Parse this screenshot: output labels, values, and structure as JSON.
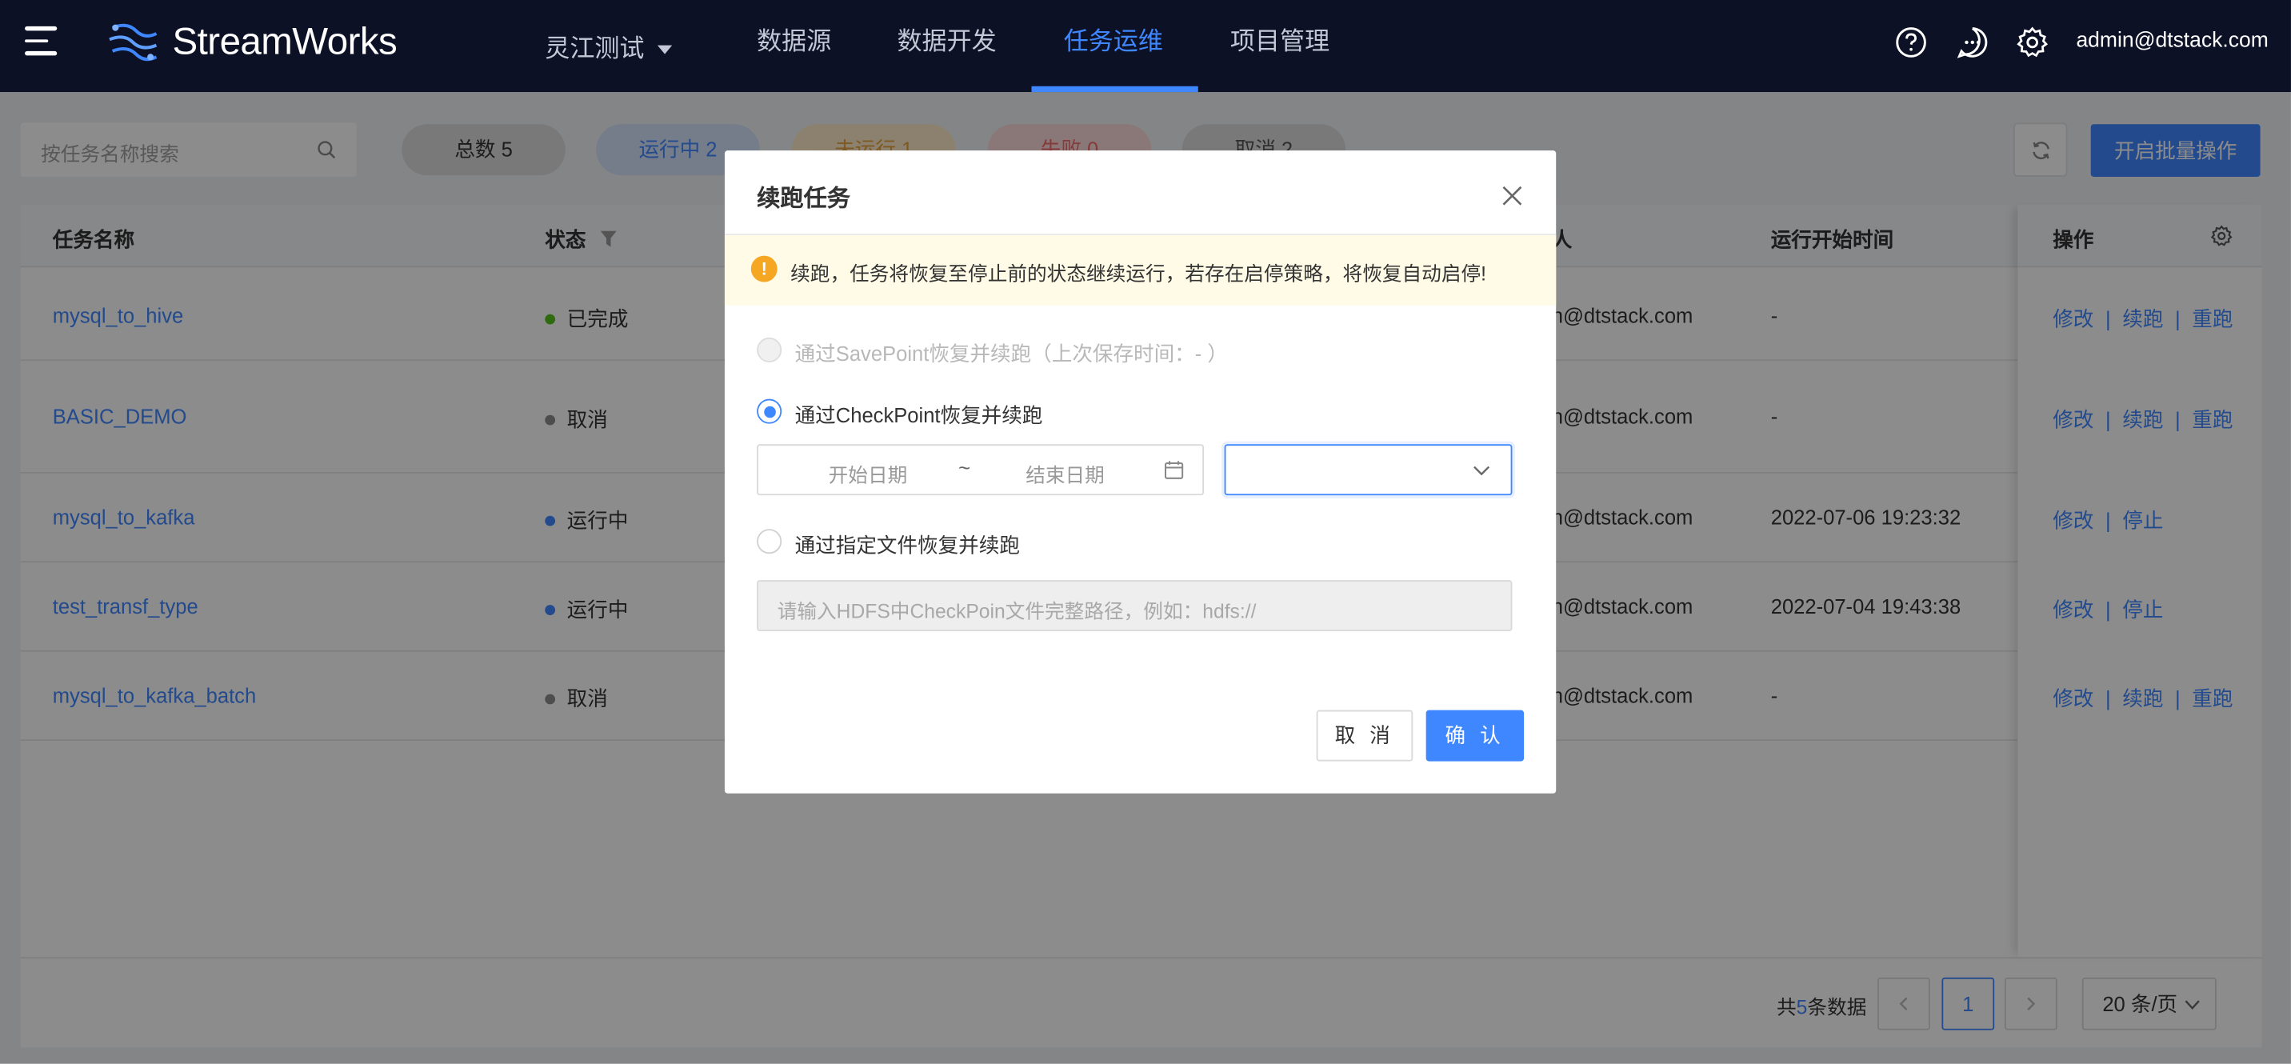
{
  "app": {
    "name": "StreamWorks",
    "user": "admin@dtstack.com"
  },
  "nav": {
    "project": "灵江测试",
    "items": [
      "数据源",
      "数据开发",
      "任务运维",
      "项目管理"
    ],
    "active_index": 2
  },
  "toolbar": {
    "search_placeholder": "按任务名称搜索",
    "filters": [
      {
        "label": "总数 5",
        "color": "#dcdcdc",
        "text_color": "#333333"
      },
      {
        "label": "运行中 2",
        "color": "#d6e4fc",
        "text_color": "#3f87ff"
      },
      {
        "label": "未运行 1",
        "color": "#fdecc8",
        "text_color": "#e6a23c"
      },
      {
        "label": "失败 0",
        "color": "#fcd9d9",
        "text_color": "#f56c6c"
      },
      {
        "label": "取消 2",
        "color": "#dcdcdc",
        "text_color": "#555555"
      }
    ],
    "batch_label": "开启批量操作"
  },
  "table": {
    "columns": {
      "name": "任务名称",
      "status": "状态",
      "owner_suffix": "人",
      "start_time": "运行开始时间",
      "ops": "操作"
    },
    "rows": [
      {
        "name": "mysql_to_hive",
        "status": "已完成",
        "status_color": "#52c41a",
        "owner": "n@dtstack.com",
        "start": "-",
        "ops": [
          "修改",
          "续跑",
          "重跑"
        ]
      },
      {
        "name": "BASIC_DEMO",
        "status": "取消",
        "status_color": "#8c8c8c",
        "owner": "n@dtstack.com",
        "start": "-",
        "ops": [
          "修改",
          "续跑",
          "重跑"
        ]
      },
      {
        "name": "mysql_to_kafka",
        "status": "运行中",
        "status_color": "#3f87ff",
        "owner": "n@dtstack.com",
        "start": "2022-07-06 19:23:32",
        "ops": [
          "修改",
          "停止"
        ]
      },
      {
        "name": "test_transf_type",
        "status": "运行中",
        "status_color": "#3f87ff",
        "owner": "n@dtstack.com",
        "start": "2022-07-04 19:43:38",
        "ops": [
          "修改",
          "停止"
        ]
      },
      {
        "name": "mysql_to_kafka_batch",
        "status": "取消",
        "status_color": "#8c8c8c",
        "owner": "n@dtstack.com",
        "start": "-",
        "ops": [
          "修改",
          "续跑",
          "重跑"
        ]
      }
    ],
    "separator": "|"
  },
  "pagination": {
    "total_prefix": "共",
    "total": "5",
    "total_suffix": "条数据",
    "current": "1",
    "page_size": "20 条/页"
  },
  "modal": {
    "title": "续跑任务",
    "alert": "续跑，任务将恢复至停止前的状态继续运行，若存在启停策略，将恢复自动启停!",
    "options": [
      {
        "label": "通过SavePoint恢复并续跑（上次保存时间：- ）",
        "disabled": true,
        "checked": false
      },
      {
        "label": "通过CheckPoint恢复并续跑",
        "disabled": false,
        "checked": true
      },
      {
        "label": "通过指定文件恢复并续跑",
        "disabled": false,
        "checked": false
      }
    ],
    "date_start_placeholder": "开始日期",
    "date_separator": "~",
    "date_end_placeholder": "结束日期",
    "path_placeholder": "请输入HDFS中CheckPoin文件完整路径，例如：hdfs://",
    "cancel_label": "取 消",
    "ok_label": "确 认"
  },
  "colors": {
    "primary": "#3f87ff",
    "header_bg": "#0d1126",
    "warning": "#f5a623"
  }
}
